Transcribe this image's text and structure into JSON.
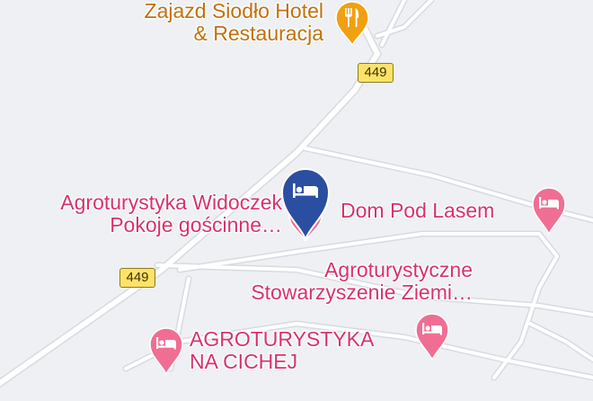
{
  "colors": {
    "background": "#eef0f3",
    "road": "#ffffff",
    "road_edge": "#d7dbe0",
    "hotel_label": "#c0710e",
    "hotel_pin": "#f29f10",
    "lodging_label": "#d6336c",
    "lodging_pin": "#f06e93",
    "selected_pin": "#2a4fa0",
    "route_shield": "#fde26a"
  },
  "route_shields": [
    {
      "label": "449"
    },
    {
      "label": "449"
    }
  ],
  "places": {
    "hotel": {
      "lines": [
        "Zajazd Siodło Hotel",
        "& Restauracja"
      ],
      "icon": "restaurant-icon"
    },
    "widoczek": {
      "lines": [
        "Agroturystyka Widoczek",
        "Pokoje gościnne…"
      ],
      "icon": "bed-icon"
    },
    "dom": {
      "lines": [
        "Dom Pod Lasem"
      ],
      "icon": "bed-icon"
    },
    "stowarzyszenie": {
      "lines": [
        "Agroturystyczne",
        "Stowarzyszenie Ziemi…"
      ],
      "icon": "bed-icon"
    },
    "cichej": {
      "lines": [
        "AGROTURYSTYKA",
        "NA CICHEJ"
      ],
      "icon": "bed-icon"
    }
  },
  "selected_marker": {
    "icon": "bed-icon"
  }
}
